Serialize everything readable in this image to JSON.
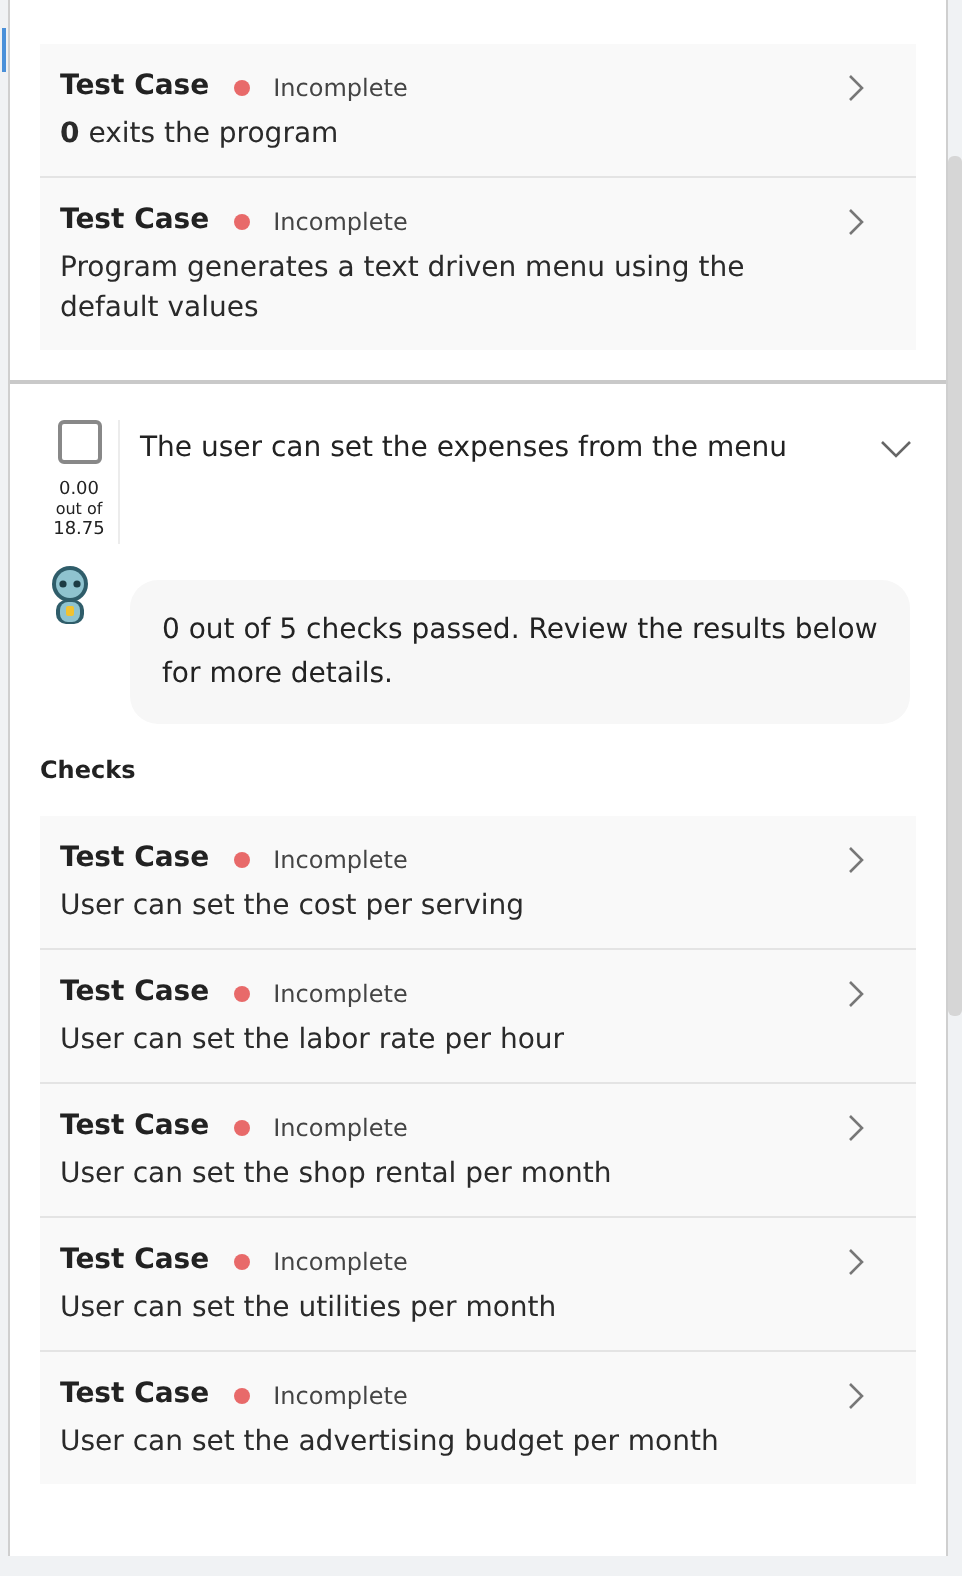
{
  "top_checks": [
    {
      "title": "Test Case",
      "status": "Incomplete",
      "color": "#e86a6a",
      "description": "**0** exits the program"
    },
    {
      "title": "Test Case",
      "status": "Incomplete",
      "color": "#e86a6a",
      "description": "Program generates a text driven menu using the default values"
    }
  ],
  "criterion": {
    "checked": false,
    "score": "0.00",
    "out_of": "out of",
    "total": "18.75",
    "title": "The user can set the expenses from the menu",
    "expanded": true
  },
  "message": "0 out of 5 checks passed. Review the results below for more details.",
  "checks_heading": "Checks",
  "checks": [
    {
      "title": "Test Case",
      "status": "Incomplete",
      "color": "#e86a6a",
      "description": "User can set the cost per serving"
    },
    {
      "title": "Test Case",
      "status": "Incomplete",
      "color": "#e86a6a",
      "description": "User can set the labor rate per hour"
    },
    {
      "title": "Test Case",
      "status": "Incomplete",
      "color": "#e86a6a",
      "description": "User can set the shop rental per month"
    },
    {
      "title": "Test Case",
      "status": "Incomplete",
      "color": "#e86a6a",
      "description": "User can set the utilities per month"
    },
    {
      "title": "Test Case",
      "status": "Incomplete",
      "color": "#e86a6a",
      "description": "User can set the advertising budget per month"
    }
  ]
}
